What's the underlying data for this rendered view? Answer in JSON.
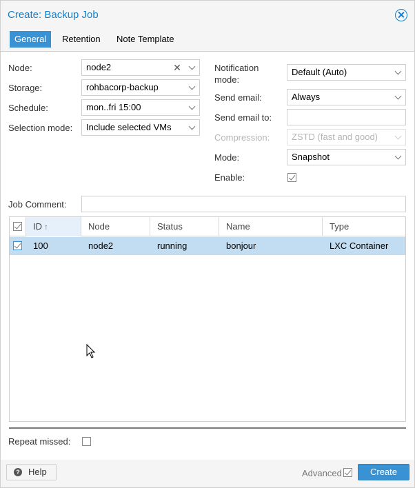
{
  "window": {
    "title": "Create: Backup Job"
  },
  "tabs": [
    {
      "label": "General"
    },
    {
      "label": "Retention"
    },
    {
      "label": "Note Template"
    }
  ],
  "form": {
    "node": {
      "label": "Node:",
      "value": "node2"
    },
    "storage": {
      "label": "Storage:",
      "value": "rohbacorp-backup"
    },
    "schedule": {
      "label": "Schedule:",
      "value": "mon..fri 15:00"
    },
    "selection_mode": {
      "label": "Selection mode:",
      "value": "Include selected VMs"
    },
    "notification_mode": {
      "label_line1": "Notification",
      "label_line2": "mode:",
      "value": "Default (Auto)"
    },
    "send_email": {
      "label": "Send email:",
      "value": "Always"
    },
    "send_email_to": {
      "label": "Send email to:",
      "value": ""
    },
    "compression": {
      "label": "Compression:",
      "value": "ZSTD (fast and good)"
    },
    "mode": {
      "label": "Mode:",
      "value": "Snapshot"
    },
    "enable": {
      "label": "Enable:",
      "checked": true
    },
    "job_comment": {
      "label": "Job Comment:",
      "value": ""
    },
    "repeat_missed": {
      "label": "Repeat missed:",
      "checked": false
    }
  },
  "grid": {
    "columns": [
      "ID",
      "Node",
      "Status",
      "Name",
      "Type"
    ],
    "rows": [
      {
        "id": "100",
        "node": "node2",
        "status": "running",
        "name": "bonjour",
        "type": "LXC Container",
        "selected": true
      }
    ]
  },
  "footer": {
    "help_label": "Help",
    "advanced_label": "Advanced",
    "advanced_checked": true,
    "create_label": "Create"
  },
  "colors": {
    "accent": "#3892d4",
    "title": "#157fcc",
    "selected_row": "#c2ddf2"
  }
}
